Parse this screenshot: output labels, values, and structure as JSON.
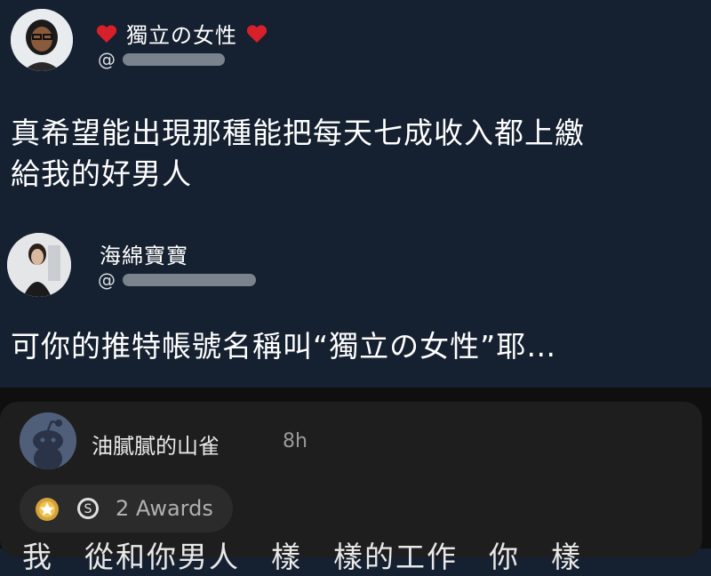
{
  "post1": {
    "display_name": "獨立の女性",
    "handle_prefix": "@",
    "text_line1": "真希望能出現那種能把每天七成收入都上繳",
    "text_line2": "給我的好男人"
  },
  "post2": {
    "display_name": "海綿寶寶",
    "handle_prefix": "@",
    "text": "可你的推特帳號名稱叫“獨立の女性”耶…"
  },
  "comment": {
    "username": "油膩膩的山雀",
    "time": "8h",
    "awards": "2 Awards",
    "body": "我　從和你男人　樣　樣的工作　你　樣"
  },
  "colors": {
    "background": "#152030",
    "heart": "#d8202a",
    "comment_background": "#1e1e1e"
  },
  "icons": [
    "heart-icon",
    "gold-award-icon",
    "silver-award-icon",
    "reddit-snoo-avatar"
  ]
}
